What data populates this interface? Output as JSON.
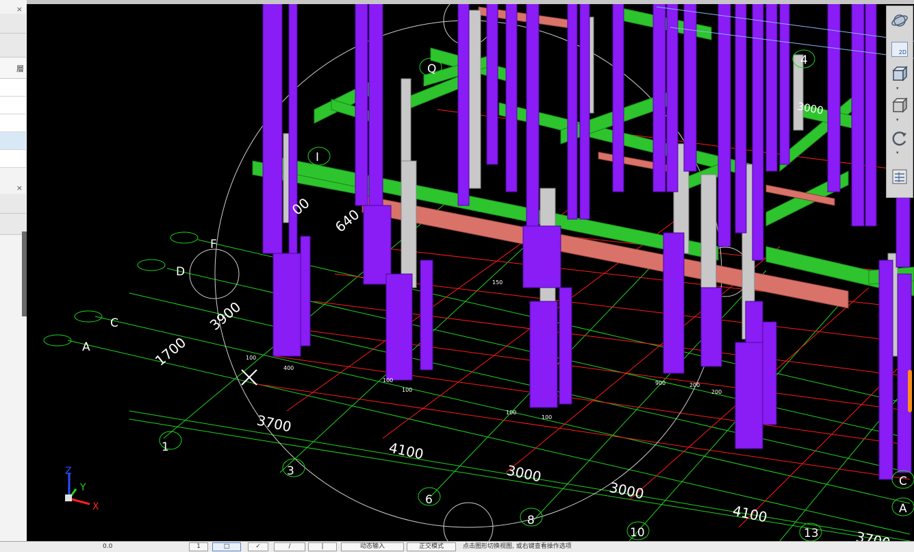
{
  "left_panel": {
    "upper_close": "×",
    "lower_close": "×",
    "header_glyph": "層"
  },
  "viewport": {
    "grid_axis_labels": [
      "F",
      "D",
      "C",
      "A",
      "1",
      "3",
      "6",
      "8",
      "10",
      "13",
      "4",
      "A",
      "C",
      "Q",
      "I"
    ],
    "dimension_labels": [
      "3900",
      "1700",
      "3700",
      "4100",
      "3000",
      "3000",
      "4100",
      "3700",
      "640",
      "00",
      "3000"
    ],
    "small_annotations": [
      "100",
      "400",
      "100",
      "100",
      "150",
      "900",
      "200",
      "200",
      "100",
      "100"
    ],
    "coordinate_triad": {
      "x": "X",
      "y": "Y",
      "z": "Z"
    },
    "colors": {
      "column": "#8a1cf5",
      "beam": "#2ec42e",
      "beam_red": "#d9736a",
      "grid_green": "#1fd41f",
      "grid_red": "#ff1a1a",
      "wall_grey": "#c8c8c8",
      "background": "#000000"
    }
  },
  "view_toolbar": {
    "items": [
      {
        "icon": "orbit-icon"
      },
      {
        "label": "2D",
        "icon": "view-2d-icon"
      },
      {
        "icon": "view-3d-box-icon"
      },
      {
        "icon": "view-cube-icon"
      },
      {
        "icon": "rotate-icon"
      },
      {
        "icon": "view-settings-icon"
      }
    ]
  },
  "status_bar": {
    "coordinate_text": "0.0",
    "buttons": [
      "1",
      "□",
      "✓",
      "/",
      "|",
      "动态输入",
      "正交模式"
    ],
    "hint_text": "点击图形切换视图, 或右键查看操作选项"
  }
}
